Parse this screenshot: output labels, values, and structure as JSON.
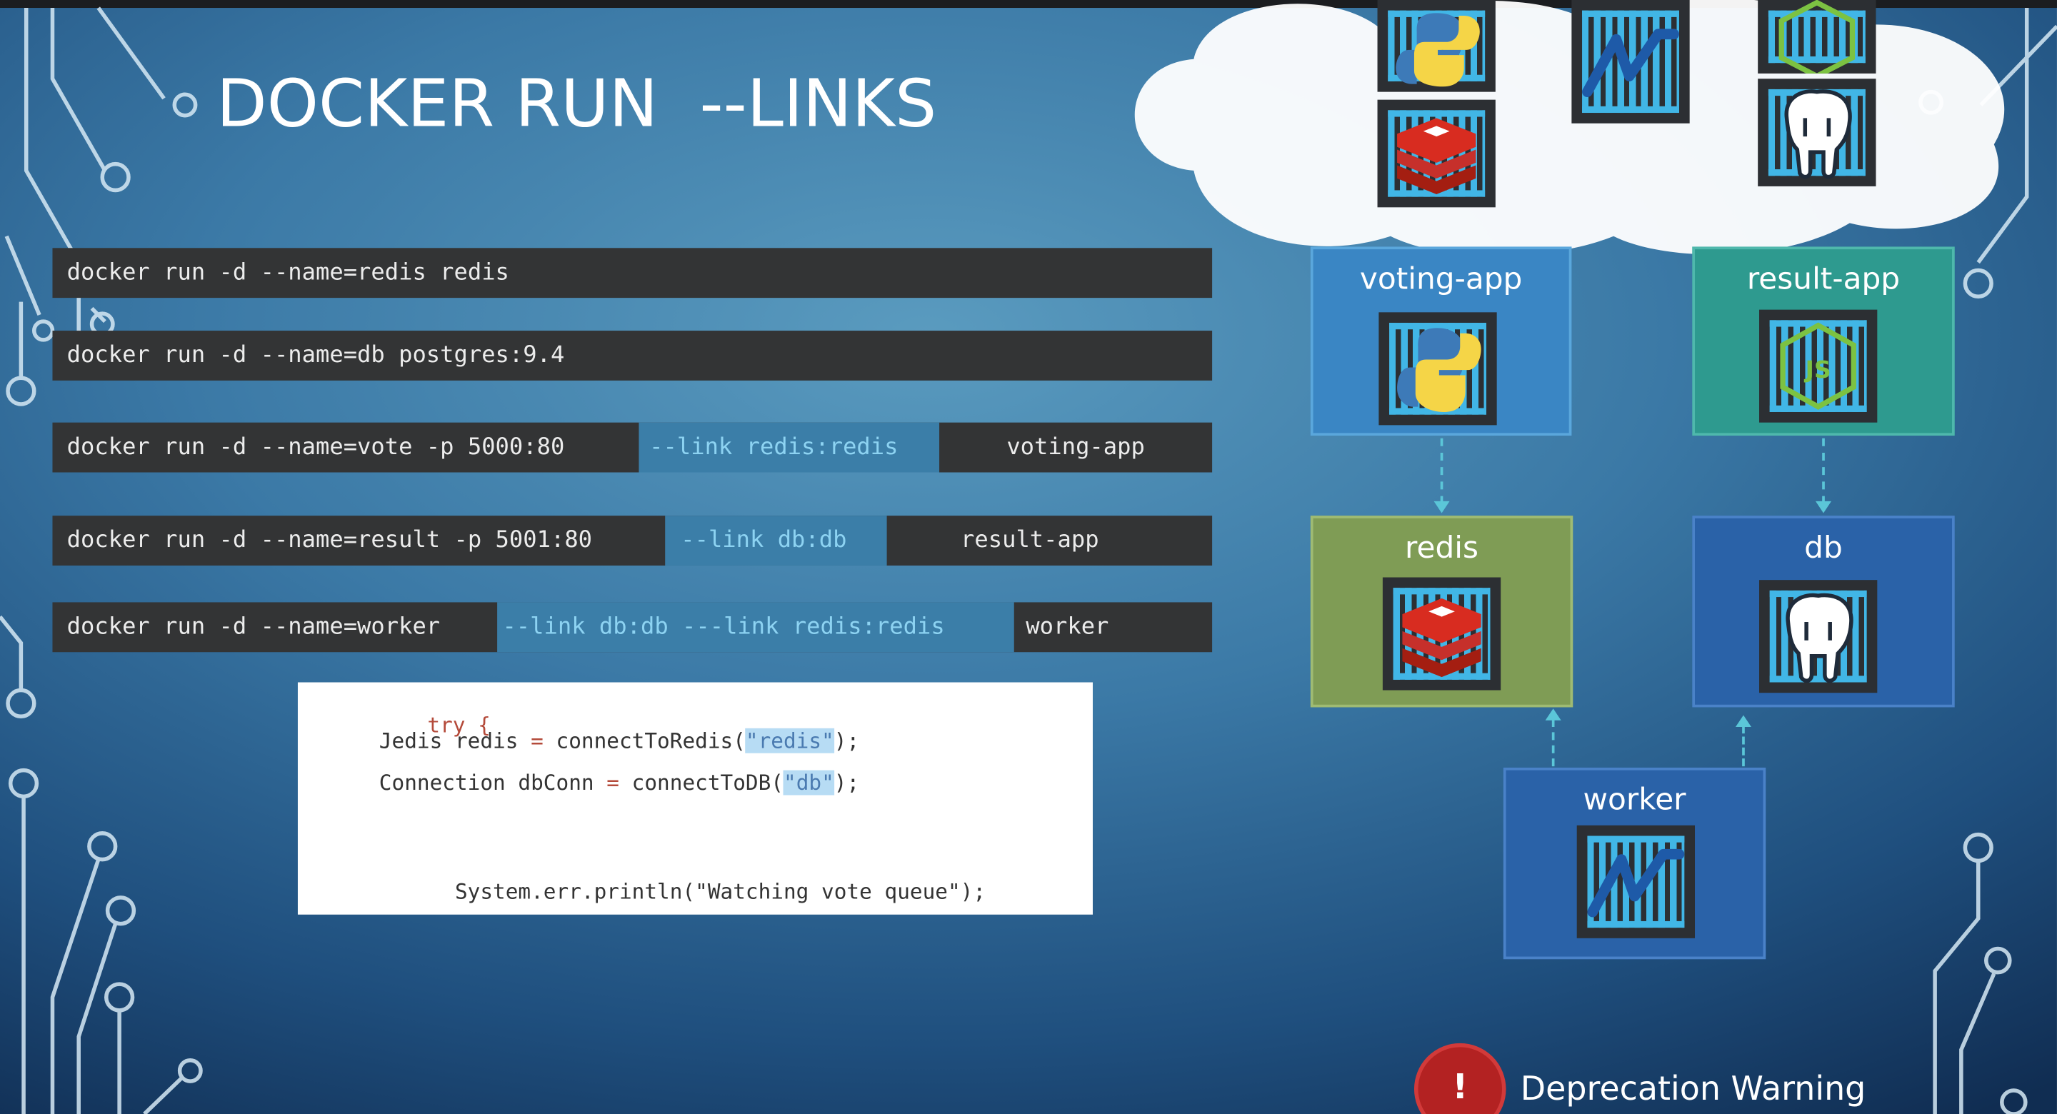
{
  "slide": {
    "title": "DOCKER RUN  --LINKS"
  },
  "commands": [
    {
      "base": "docker run -d --name=redis redis"
    },
    {
      "base": "docker run -d --name=db postgres:9.4"
    },
    {
      "base": "docker run -d --name=vote -p 5000:80",
      "link": "--link redis:redis",
      "name": "voting-app"
    },
    {
      "base": "docker run -d --name=result -p 5001:80",
      "link": "--link db:db",
      "name": "result-app"
    },
    {
      "base": "docker run -d --name=worker",
      "link": "--link db:db ---link redis:redis",
      "name": "worker"
    }
  ],
  "code": {
    "line1": "try {",
    "line2_a": "Jedis redis ",
    "line2_op": "=",
    "line2_b": " connectToRedis(",
    "line2_hl": "\"redis\"",
    "line2_c": ");",
    "line3_a": "Connection dbConn ",
    "line3_op": "=",
    "line3_b": " connectToDB(",
    "line3_hl": "\"db\"",
    "line3_c": ");",
    "line4": "System.err.println(\"Watching vote queue\");"
  },
  "diagram": {
    "boxes": {
      "voting_app": "voting-app",
      "result_app": "result-app",
      "redis": "redis",
      "db": "db",
      "worker": "worker"
    },
    "colors": {
      "voting_app": "#3a86c4",
      "result_app": "#2e9a8f",
      "redis": "#7f9c55",
      "db": "#2a62a8",
      "worker": "#2a62a8",
      "container_stripes": "#41b6e6"
    },
    "icons": [
      "python-icon",
      "redis-icon",
      "dotnet-icon",
      "nodejs-icon",
      "postgres-icon"
    ]
  },
  "warning": {
    "symbol": "!",
    "text": "Deprecation Warning"
  }
}
